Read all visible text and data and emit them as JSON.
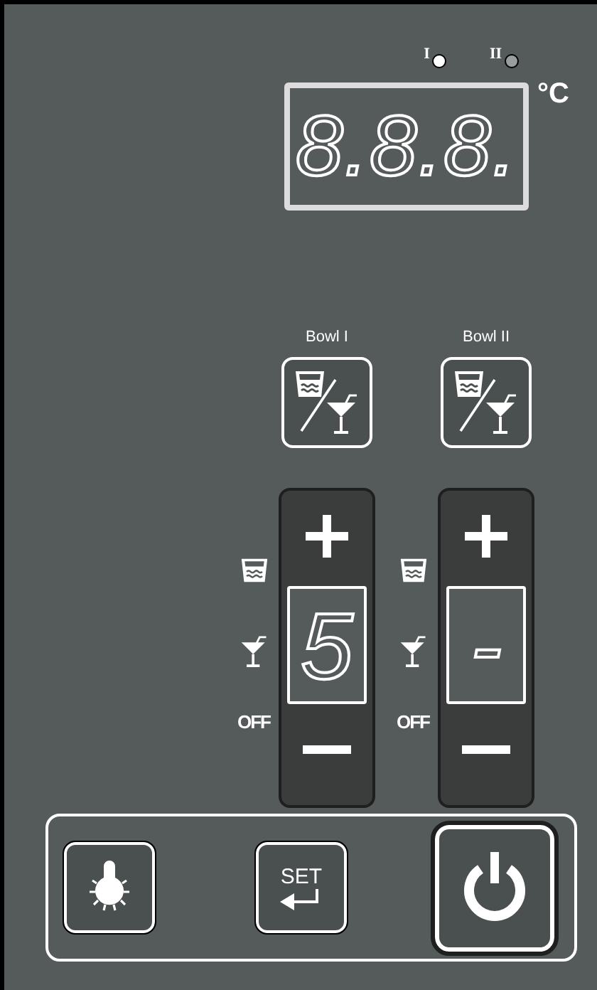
{
  "indicators": [
    {
      "label": "I",
      "on": true
    },
    {
      "label": "II",
      "on": false
    }
  ],
  "display": {
    "value": "8.8.8.",
    "unit": "°C"
  },
  "bowls": [
    {
      "label": "Bowl I",
      "value": "5",
      "off_label": "OFF"
    },
    {
      "label": "Bowl II",
      "value": "-",
      "off_label": "OFF"
    }
  ],
  "buttons": [
    {
      "kind": "light"
    },
    {
      "kind": "set",
      "label": "SET"
    },
    {
      "kind": "power"
    }
  ]
}
